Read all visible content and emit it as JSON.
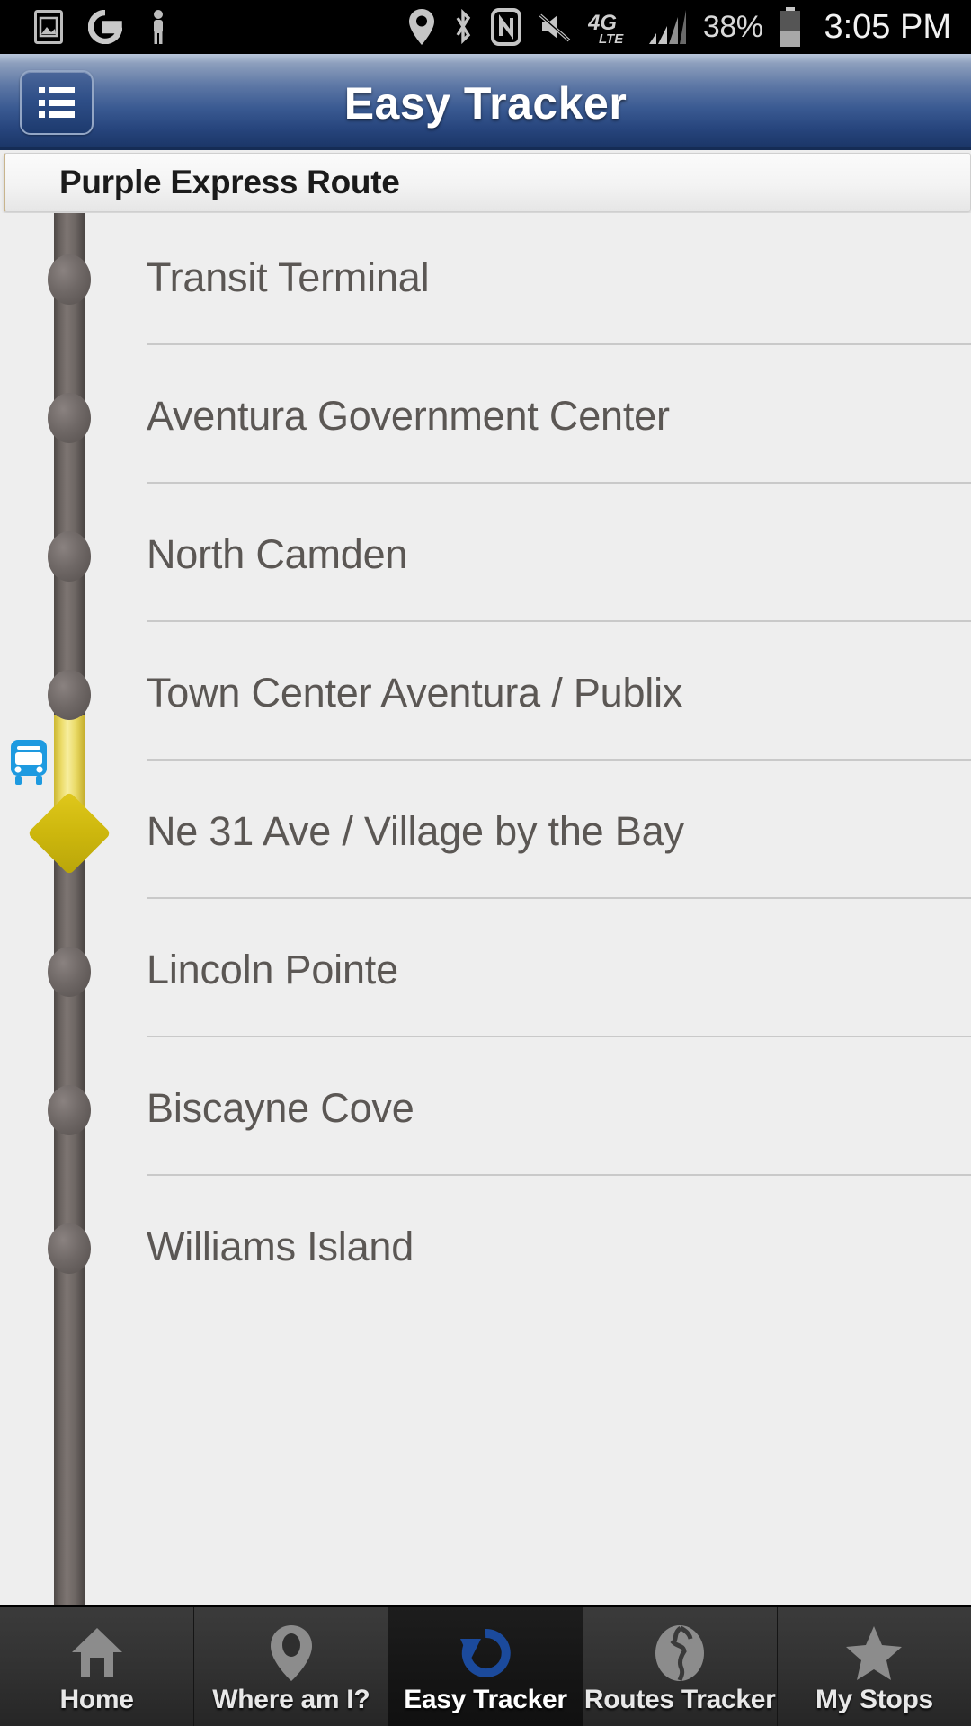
{
  "status_bar": {
    "icons": [
      "gallery-icon",
      "google-g-icon",
      "pedestrian-icon",
      "location-pin-icon",
      "bluetooth-icon",
      "nfc-icon",
      "volume-muted-icon",
      "4g-lte-icon",
      "signal-bars-icon"
    ],
    "network_label": "4G",
    "network_sub_label": "LTE",
    "battery_percent": "38%",
    "clock": "3:05 PM"
  },
  "header": {
    "title": "Easy Tracker",
    "menu_icon": "list-menu-icon"
  },
  "route_panel": {
    "title": "Purple Express Route"
  },
  "stops": [
    {
      "name": "Transit Terminal",
      "current": false
    },
    {
      "name": "Aventura Government Center",
      "current": false
    },
    {
      "name": "North Camden",
      "current": false
    },
    {
      "name": "Town Center Aventura / Publix",
      "current": false
    },
    {
      "name": "Ne 31 Ave / Village by the Bay",
      "current": true
    },
    {
      "name": "Lincoln Pointe",
      "current": false
    },
    {
      "name": "Biscayne Cove",
      "current": false
    },
    {
      "name": "Williams Island",
      "current": false
    }
  ],
  "vehicle": {
    "icon": "bus-icon",
    "color": "#1e9ae0"
  },
  "colors": {
    "header_top": "#b9c6da",
    "header_bottom": "#1b3667",
    "route_line": "#6b6461",
    "highlight": "#ecdc6a",
    "current_marker": "#cdb70d",
    "stop_text": "#5b5754",
    "accent_blue": "#1b4a9c"
  },
  "tabs": [
    {
      "label": "Home",
      "icon": "home-icon",
      "active": false
    },
    {
      "label": "Where am I?",
      "icon": "location-pin-icon",
      "active": false
    },
    {
      "label": "Easy Tracker",
      "icon": "rotate-arrow-icon",
      "active": true
    },
    {
      "label": "Routes Tracker",
      "icon": "globe-icon",
      "active": false
    },
    {
      "label": "My Stops",
      "icon": "star-icon",
      "active": false
    }
  ]
}
